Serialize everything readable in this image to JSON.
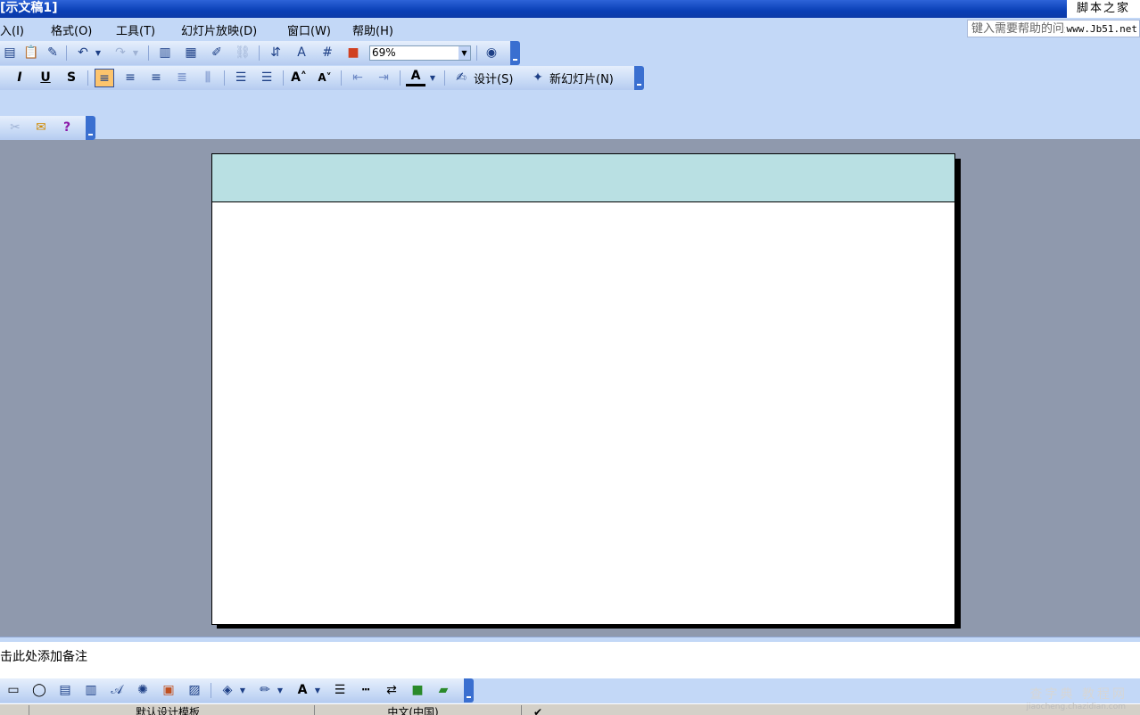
{
  "window": {
    "title": "[示文稿1]",
    "watermark": "脚本之家"
  },
  "menubar": {
    "items": [
      {
        "label": "入(I)"
      },
      {
        "label": "格式(O)"
      },
      {
        "label": "工具(T)"
      },
      {
        "label": "幻灯片放映(D)"
      },
      {
        "label": "窗口(W)"
      },
      {
        "label": "帮助(H)"
      }
    ],
    "help_placeholder": "键入需要帮助的问题",
    "help_site": "www.Jb51.net"
  },
  "standard_toolbar": {
    "zoom_value": "69%"
  },
  "format_toolbar": {
    "italic": "I",
    "underline": "U",
    "shadow": "S",
    "design_label": "设计(S)",
    "new_slide_label": "新幻灯片(N)"
  },
  "notes": {
    "placeholder": "击此处添加备注"
  },
  "statusbar": {
    "template": "默认设计模板",
    "language": "中文(中国)"
  },
  "watermark2": "查字典 教程网",
  "watermark3": "jiaocheng.chazidian.com",
  "colors": {
    "accent": "#c3d8f7",
    "slide_band": "#b9e0e3",
    "workspace": "#8f99ad"
  }
}
